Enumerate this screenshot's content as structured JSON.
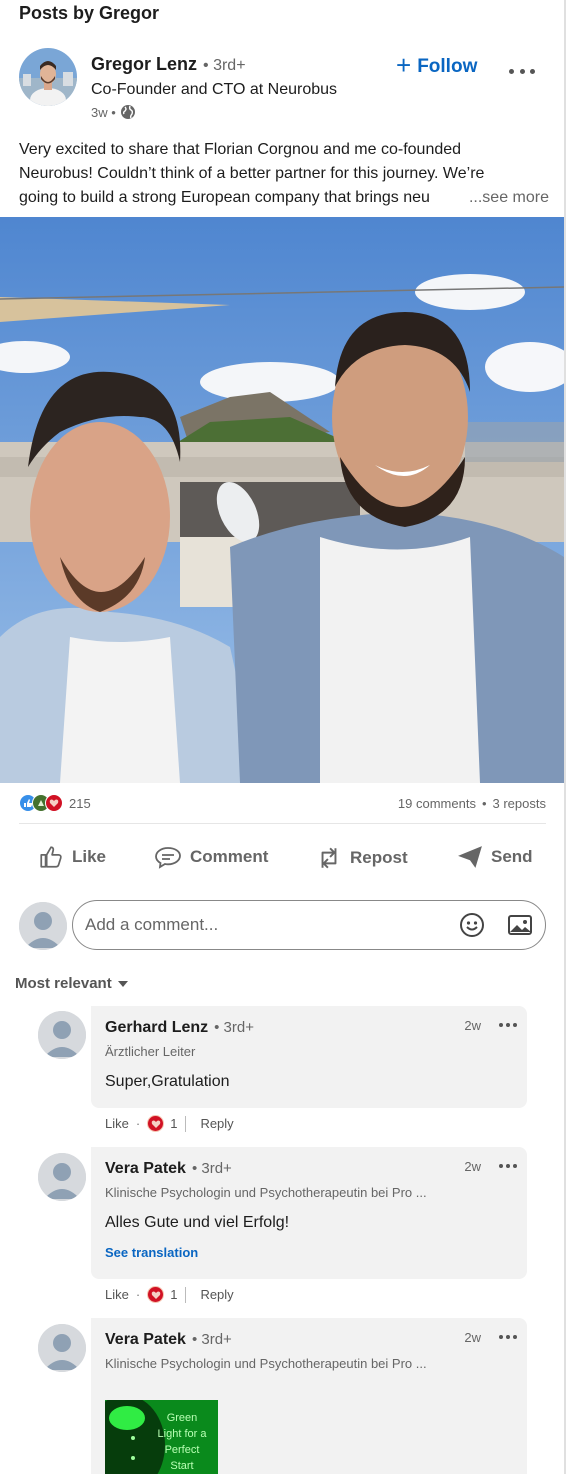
{
  "section_title": "Posts by Gregor",
  "post": {
    "author_name": "Gregor Lenz",
    "author_degree": "• 3rd+",
    "author_headline": "Co-Founder and CTO at Neurobus",
    "time": "3w •",
    "follow_label": "Follow",
    "text_lines": [
      "Very excited to share that Florian Corgnou and me co-founded",
      "Neurobus! Couldn’t think of a better partner for this journey. We’re",
      "going to build a strong European company that brings neu"
    ],
    "see_more": "...see more",
    "reaction_count": "215",
    "comments_count": "19 comments",
    "reposts_count": "3 reposts"
  },
  "actions": {
    "like": "Like",
    "comment": "Comment",
    "repost": "Repost",
    "send": "Send"
  },
  "comment_box": {
    "placeholder": "Add a comment..."
  },
  "sort_label": "Most relevant",
  "comments": [
    {
      "name": "Gerhard Lenz",
      "degree": "• 3rd+",
      "headline": "Ärztlicher Leiter",
      "time": "2w",
      "text": "Super,Gratulation",
      "like_label": "Like",
      "reactions": "1",
      "reply_label": "Reply"
    },
    {
      "name": "Vera Patek",
      "degree": "• 3rd+",
      "headline": "Klinische Psychologin und Psychotherapeutin bei Pro ...",
      "time": "2w",
      "text": "Alles Gute und viel Erfolg!",
      "translate": "See translation",
      "like_label": "Like",
      "reactions": "1",
      "reply_label": "Reply"
    },
    {
      "name": "Vera Patek",
      "degree": "• 3rd+",
      "headline": "Klinische Psychologin und Psychotherapeutin bei Pro ...",
      "time": "2w",
      "image_text": [
        "Green",
        "Light for a",
        "Perfect",
        "Start"
      ]
    }
  ],
  "colors": {
    "accent": "#0a66c2",
    "text_secondary": "#666666",
    "bubble_bg": "#f2f2f2"
  }
}
